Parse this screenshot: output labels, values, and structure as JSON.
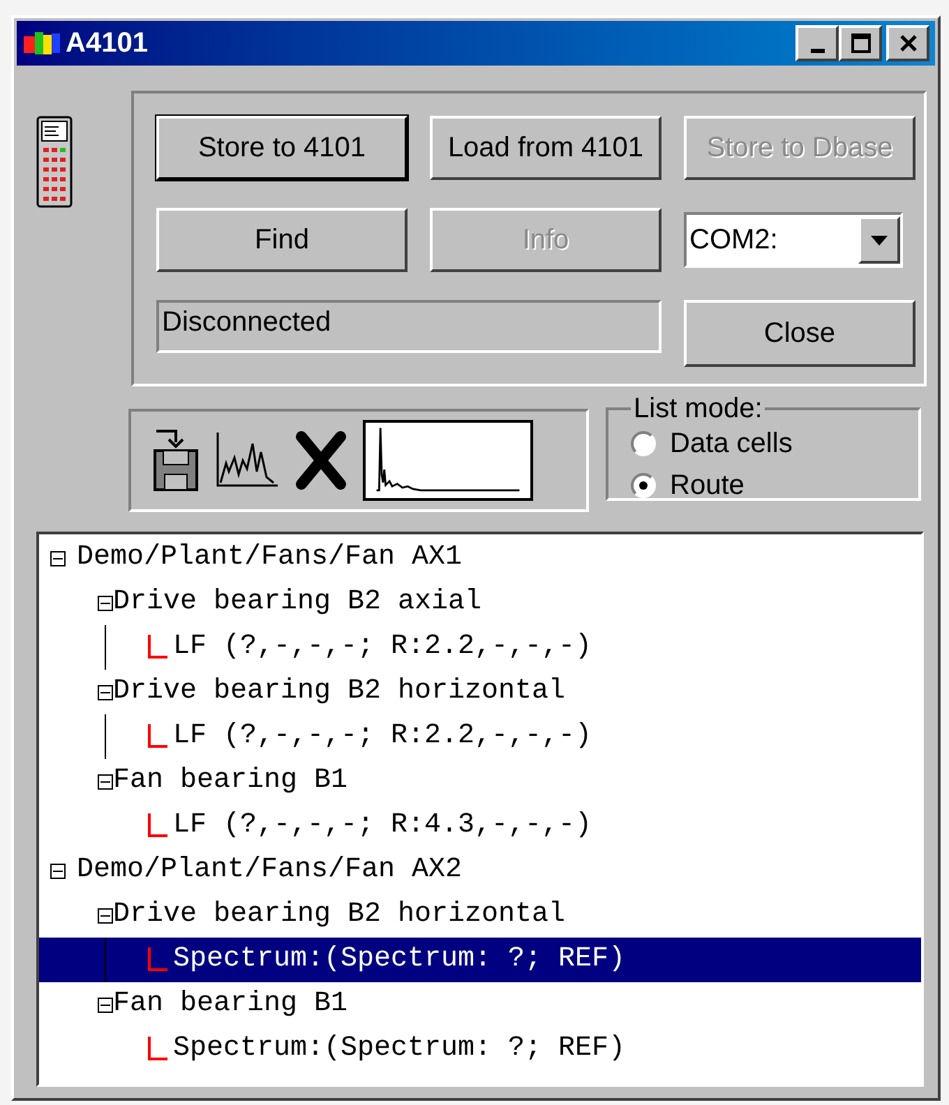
{
  "window": {
    "title": "A4101"
  },
  "buttons": [
    {
      "label": "Store to 4101",
      "disabled": false,
      "default": true
    },
    {
      "label": "Load from 4101",
      "disabled": false,
      "default": false
    },
    {
      "label": "Store to Dbase",
      "disabled": true,
      "default": false
    },
    {
      "label": "Find",
      "disabled": false,
      "default": false
    },
    {
      "label": "Info",
      "disabled": true,
      "default": false
    }
  ],
  "port_select": {
    "value": "COM2:"
  },
  "status_field": {
    "value": "Disconnected"
  },
  "close_button": {
    "label": "Close"
  },
  "list_mode": {
    "title": "List mode:",
    "options": [
      {
        "label": "Data cells",
        "selected": false
      },
      {
        "label": "Route",
        "selected": true
      }
    ]
  },
  "tree": [
    {
      "label": "Demo/Plant/Fans/Fan AX1",
      "expanded": true,
      "selected": false,
      "children": [
        {
          "label": "Drive bearing B2 axial",
          "expanded": true,
          "selected": false,
          "children": [
            {
              "label": "LF (?,-,-,-; R:2.2,-,-,-)",
              "selected": false
            }
          ]
        },
        {
          "label": "Drive bearing B2 horizontal",
          "expanded": true,
          "selected": false,
          "children": [
            {
              "label": "LF (?,-,-,-; R:2.2,-,-,-)",
              "selected": false
            }
          ]
        },
        {
          "label": "Fan bearing B1",
          "expanded": true,
          "selected": false,
          "children": [
            {
              "label": "LF (?,-,-,-; R:4.3,-,-,-)",
              "selected": false
            }
          ]
        }
      ]
    },
    {
      "label": "Demo/Plant/Fans/Fan AX2",
      "expanded": true,
      "selected": false,
      "children": [
        {
          "label": "Drive bearing B2 horizontal",
          "expanded": true,
          "selected": false,
          "children": [
            {
              "label": "Spectrum:(Spectrum: ?; REF)",
              "selected": true
            }
          ]
        },
        {
          "label": "Fan bearing B1",
          "expanded": true,
          "selected": false,
          "children": [
            {
              "label": "Spectrum:(Spectrum: ?; REF)",
              "selected": false
            }
          ]
        }
      ]
    }
  ]
}
